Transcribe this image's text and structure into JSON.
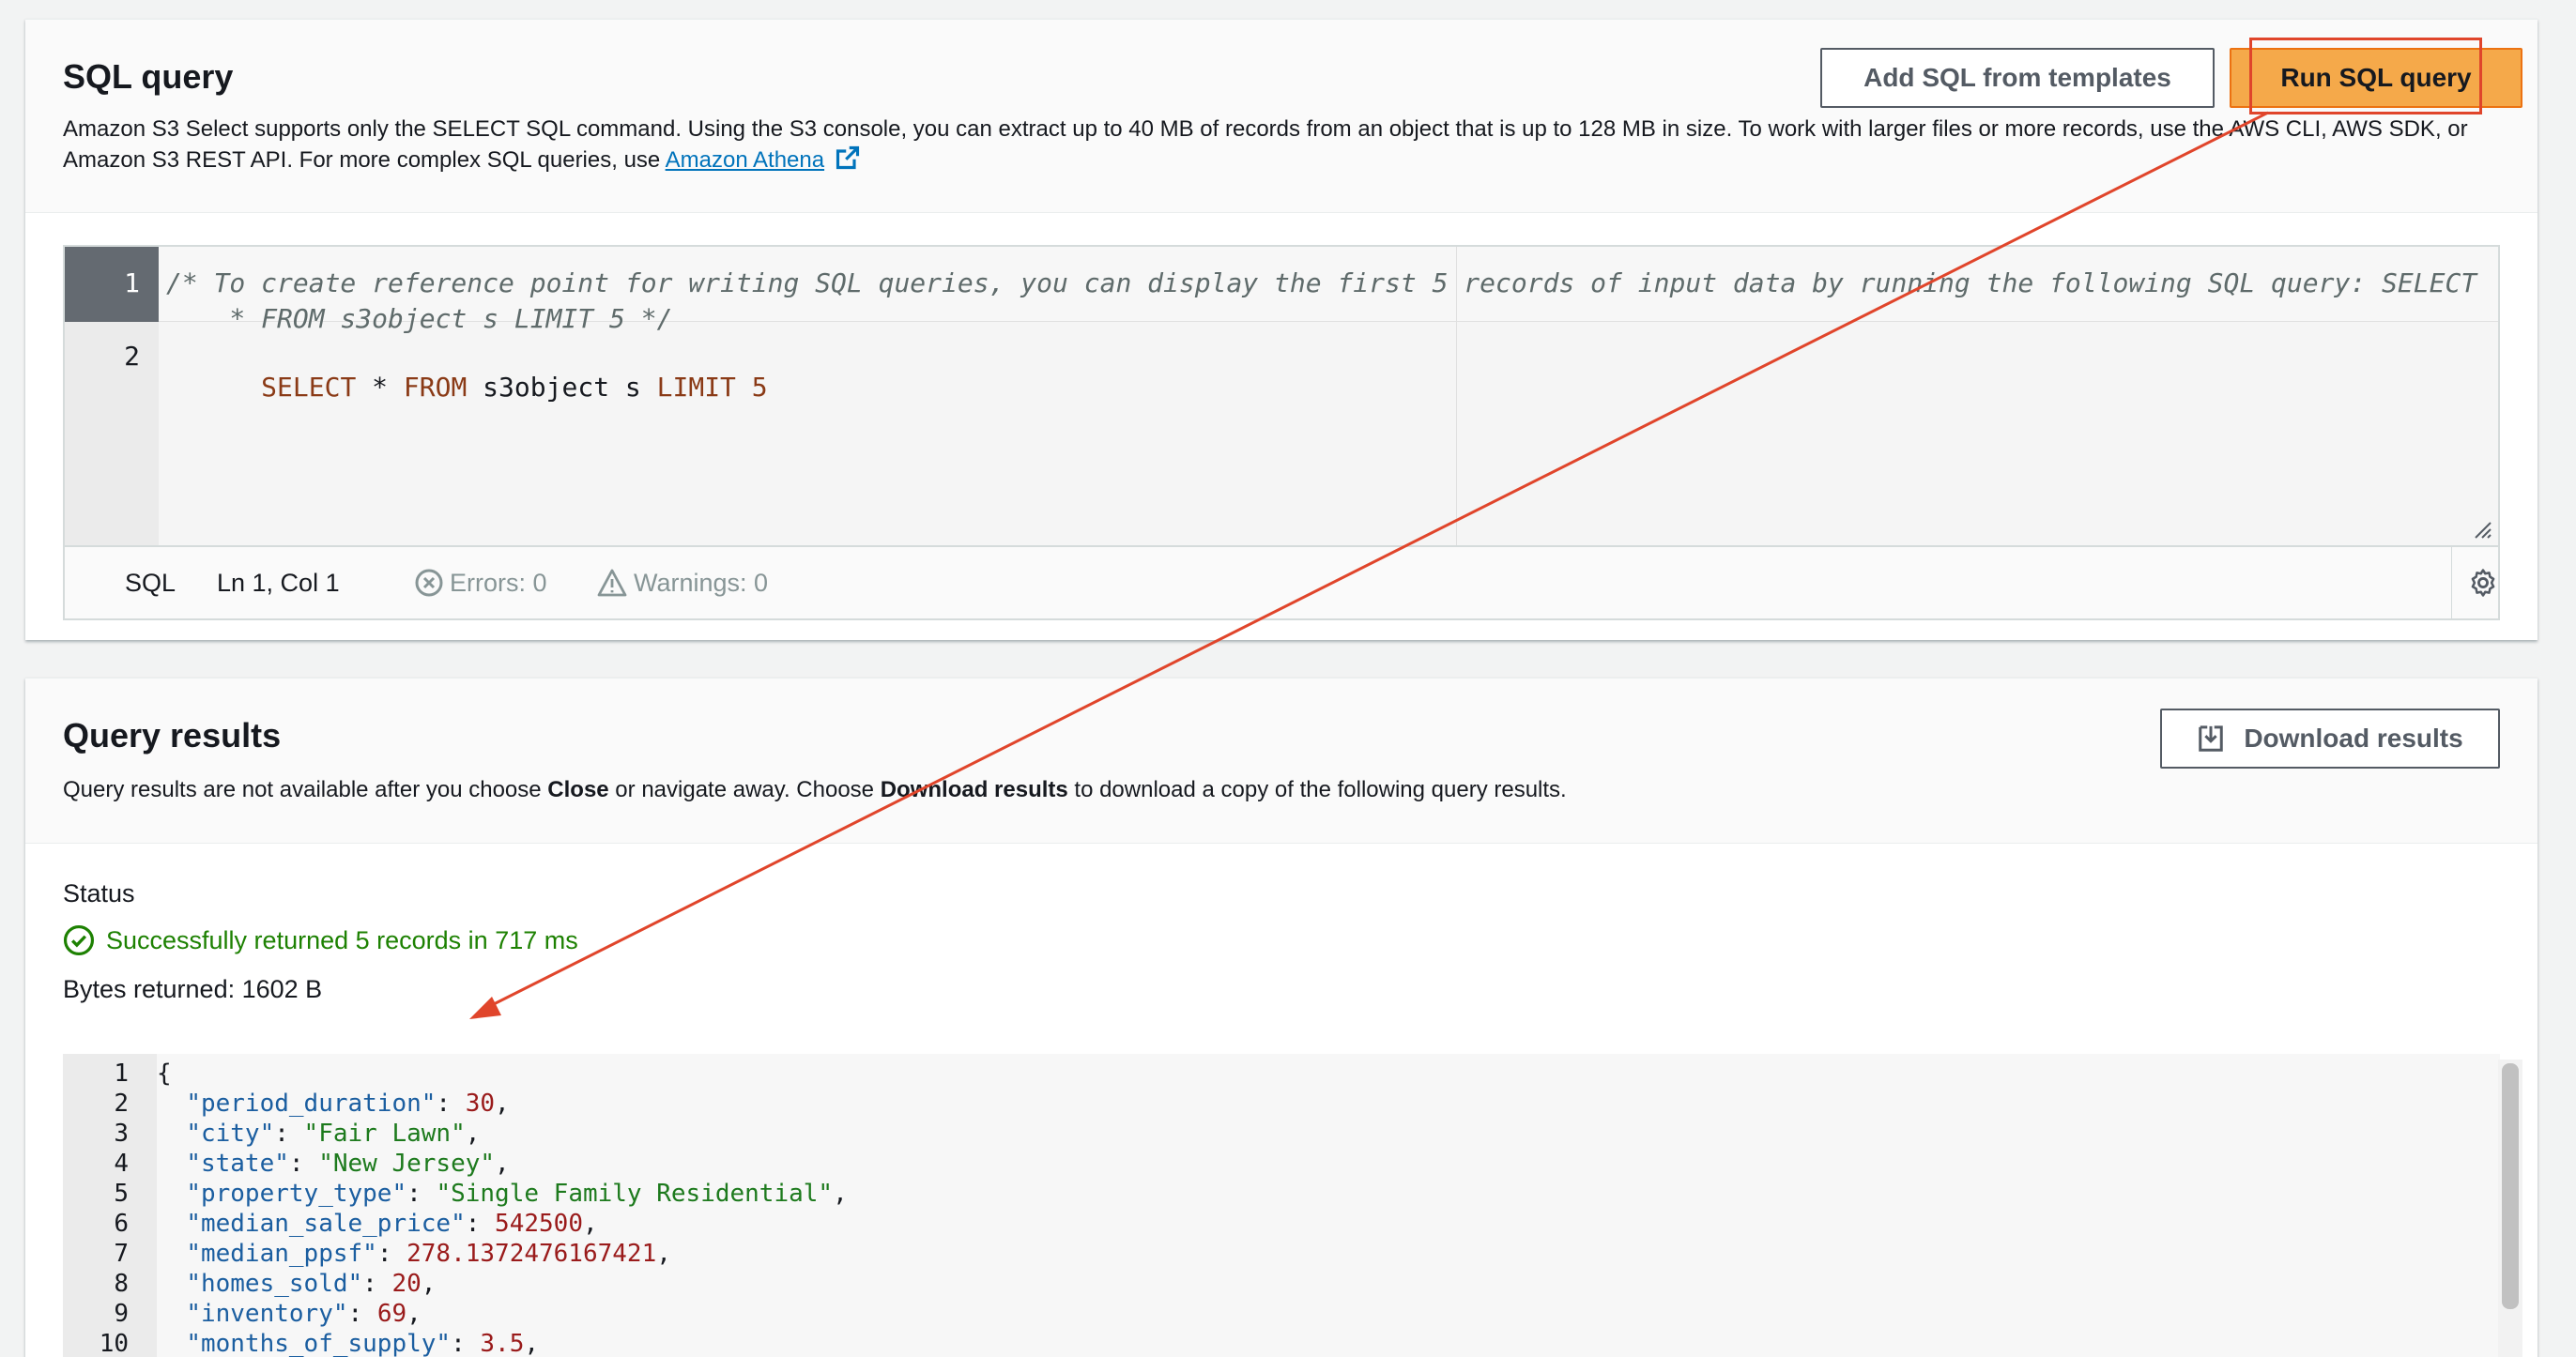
{
  "sql_panel": {
    "title": "SQL query",
    "description_pre": "Amazon S3 Select supports only the SELECT SQL command. Using the S3 console, you can extract up to 40 MB of records from an object that is up to 128 MB in size. To work with larger files or more records, use the AWS CLI, AWS SDK, or Amazon S3 REST API. For more complex SQL queries, use ",
    "description_link": "Amazon Athena",
    "add_templates_label": "Add SQL from templates",
    "run_label": "Run SQL query",
    "editor": {
      "line_numbers": [
        "1",
        "2"
      ],
      "line1_a": "/* To create reference point for writing SQL queries, you can display the first 5 records of input data by running the following SQL query: SELECT",
      "line1_b": "    * FROM s3object s LIMIT 5 */",
      "line2_kw1": "SELECT",
      "line2_p1": " * ",
      "line2_kw2": "FROM",
      "line2_p2": " s3object s ",
      "line2_kw3": "LIMIT",
      "line2_num": " 5"
    },
    "status": {
      "language": "SQL",
      "position": "Ln 1, Col 1",
      "errors": "Errors: 0",
      "warnings": "Warnings: 0"
    }
  },
  "results_panel": {
    "title": "Query results",
    "desc_1": "Query results are not available after you choose ",
    "desc_close": "Close",
    "desc_2": " or navigate away. Choose ",
    "desc_download": "Download results",
    "desc_3": " to download a copy of the following query results.",
    "download_label": "Download results",
    "status_label": "Status",
    "status_message": "Successfully returned 5 records in 717 ms",
    "bytes_returned": "Bytes returned: 1602 B",
    "json_lines": [
      {
        "n": "1",
        "text": "{",
        "key": "",
        "val": "",
        "type": "brace"
      },
      {
        "n": "2",
        "key": "\"period_duration\"",
        "val": "30",
        "type": "num"
      },
      {
        "n": "3",
        "key": "\"city\"",
        "val": "\"Fair Lawn\"",
        "type": "str"
      },
      {
        "n": "4",
        "key": "\"state\"",
        "val": "\"New Jersey\"",
        "type": "str"
      },
      {
        "n": "5",
        "key": "\"property_type\"",
        "val": "\"Single Family Residential\"",
        "type": "str"
      },
      {
        "n": "6",
        "key": "\"median_sale_price\"",
        "val": "542500",
        "type": "num"
      },
      {
        "n": "7",
        "key": "\"median_ppsf\"",
        "val": "278.1372476167421",
        "type": "num"
      },
      {
        "n": "8",
        "key": "\"homes_sold\"",
        "val": "20",
        "type": "num"
      },
      {
        "n": "9",
        "key": "\"inventory\"",
        "val": "69",
        "type": "num"
      },
      {
        "n": "10",
        "key": "\"months_of_supply\"",
        "val": "3.5",
        "type": "num"
      }
    ]
  },
  "colors": {
    "primary_button": "#f5a94a",
    "annotation": "#e0452b",
    "success": "#1d8102",
    "link": "#0073bb"
  }
}
